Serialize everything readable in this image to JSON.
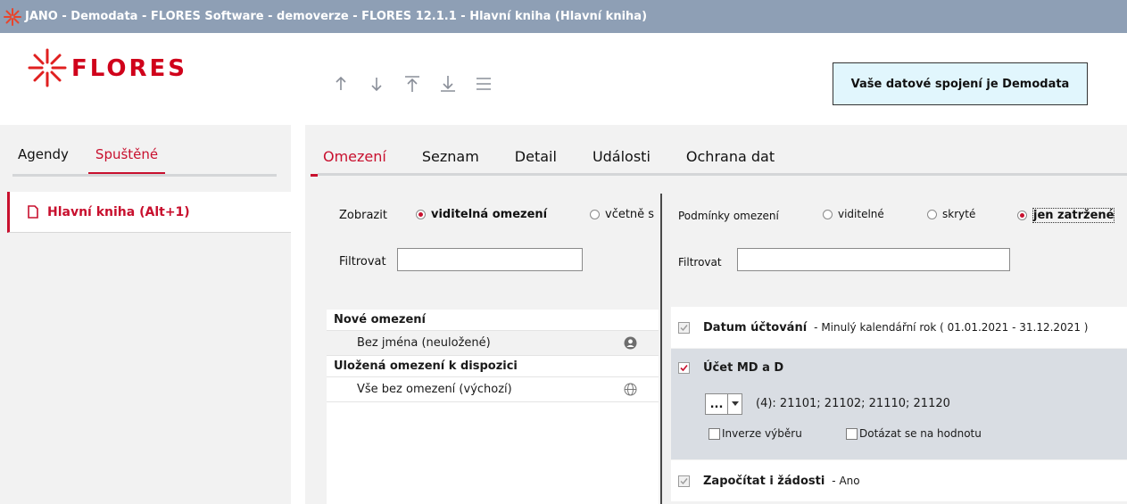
{
  "window": {
    "title": "JANO - Demodata - FLORES Software - demoverze - FLORES 12.1.1 - Hlavní kniha  (Hlavní kniha)"
  },
  "header": {
    "logo_text": "FLORES",
    "nav_icons": [
      "arrow-up-icon",
      "arrow-down-icon",
      "arrow-to-top-icon",
      "arrow-to-bottom-icon",
      "menu-icon"
    ],
    "connection_label": "Vaše datové spojení je Demodata"
  },
  "sidebar": {
    "tabs": [
      {
        "label": "Agendy",
        "active": false
      },
      {
        "label": "Spuštěné",
        "active": true
      }
    ],
    "items": [
      {
        "label": "Hlavní kniha (Alt+1)"
      }
    ]
  },
  "main": {
    "tabs": [
      {
        "label": "Omezení",
        "active": true
      },
      {
        "label": "Seznam",
        "active": false
      },
      {
        "label": "Detail",
        "active": false
      },
      {
        "label": "Události",
        "active": false
      },
      {
        "label": "Ochrana dat",
        "active": false
      }
    ],
    "left": {
      "show_label": "Zobrazit",
      "show_options": [
        {
          "label": "viditelná omezení",
          "selected": true
        },
        {
          "label": "včetně s",
          "selected": false
        }
      ],
      "filter_label": "Filtrovat",
      "filter_value": "",
      "list": [
        {
          "group": "Nové omezení",
          "items": [
            {
              "label": "Bez jména (neuložené)",
              "icon": "user-icon",
              "selected": true
            }
          ]
        },
        {
          "group": "Uložená omezení k dispozici",
          "items": [
            {
              "label": "Vše bez omezení (výchozí)",
              "icon": "globe-icon",
              "selected": false
            }
          ]
        }
      ]
    },
    "right": {
      "conditions_label": "Podmínky omezení",
      "condition_options": [
        {
          "label": "viditelné",
          "selected": false
        },
        {
          "label": "skryté",
          "selected": false
        },
        {
          "label": "jen zatržené",
          "selected": true
        }
      ],
      "filter_label": "Filtrovat",
      "filter_value": "",
      "conditions": [
        {
          "name": "Datum účtování",
          "value": "- Minulý kalendářní rok ( 01.01.2021 - 31.12.2021 )",
          "checked": true
        },
        {
          "name": "Účet MD a D",
          "value": "(4): 21101; 21102; 21110; 21120",
          "checked": true,
          "dropdown_label": "...",
          "option1": "Inverze výběru",
          "option2": "Dotázat se na hodnotu"
        },
        {
          "name": "Započítat i žádosti",
          "value": "- Ano",
          "checked": true
        }
      ]
    }
  },
  "colors": {
    "accent": "#c8102e",
    "titlebar": "#8e9fb5",
    "connection_bg": "#e1f6fd",
    "panel_bg": "#f2f2f2",
    "selected_condition_bg": "#d9dde3"
  }
}
